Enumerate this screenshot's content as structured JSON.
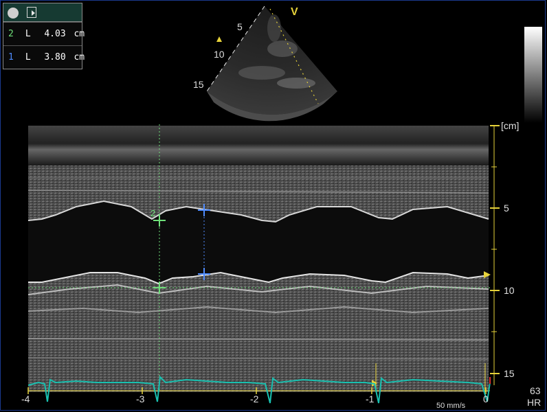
{
  "measurements": {
    "rows": [
      {
        "index": "2",
        "type": "L",
        "value": "4.03",
        "unit": "cm",
        "color": "#6fe07a"
      },
      {
        "index": "1",
        "type": "L",
        "value": "3.80",
        "unit": "cm",
        "color": "#4f8cff"
      }
    ]
  },
  "sector": {
    "orientation_mark": "V",
    "depth_labels": [
      "5",
      "10",
      "15"
    ]
  },
  "mmode": {
    "unit_label": "[cm]",
    "depth_ticks": [
      "5",
      "10",
      "15"
    ],
    "time_ticks": [
      "-4",
      "-3",
      "-2",
      "-1",
      "0"
    ],
    "sweep_speed": "50 mm/s",
    "heart_rate_value": "63",
    "heart_rate_label": "HR",
    "caliper_2_label": "2"
  },
  "colors": {
    "ecg": "#19c0b0",
    "caliper_green": "#6fe07a",
    "caliper_blue": "#4f8cff",
    "marker_yellow": "#e6d23a",
    "frame_border": "#1b3a8f"
  },
  "icons": [
    "record-icon",
    "pointer-icon",
    "depth-marker-icon",
    "time-marker-icon"
  ]
}
